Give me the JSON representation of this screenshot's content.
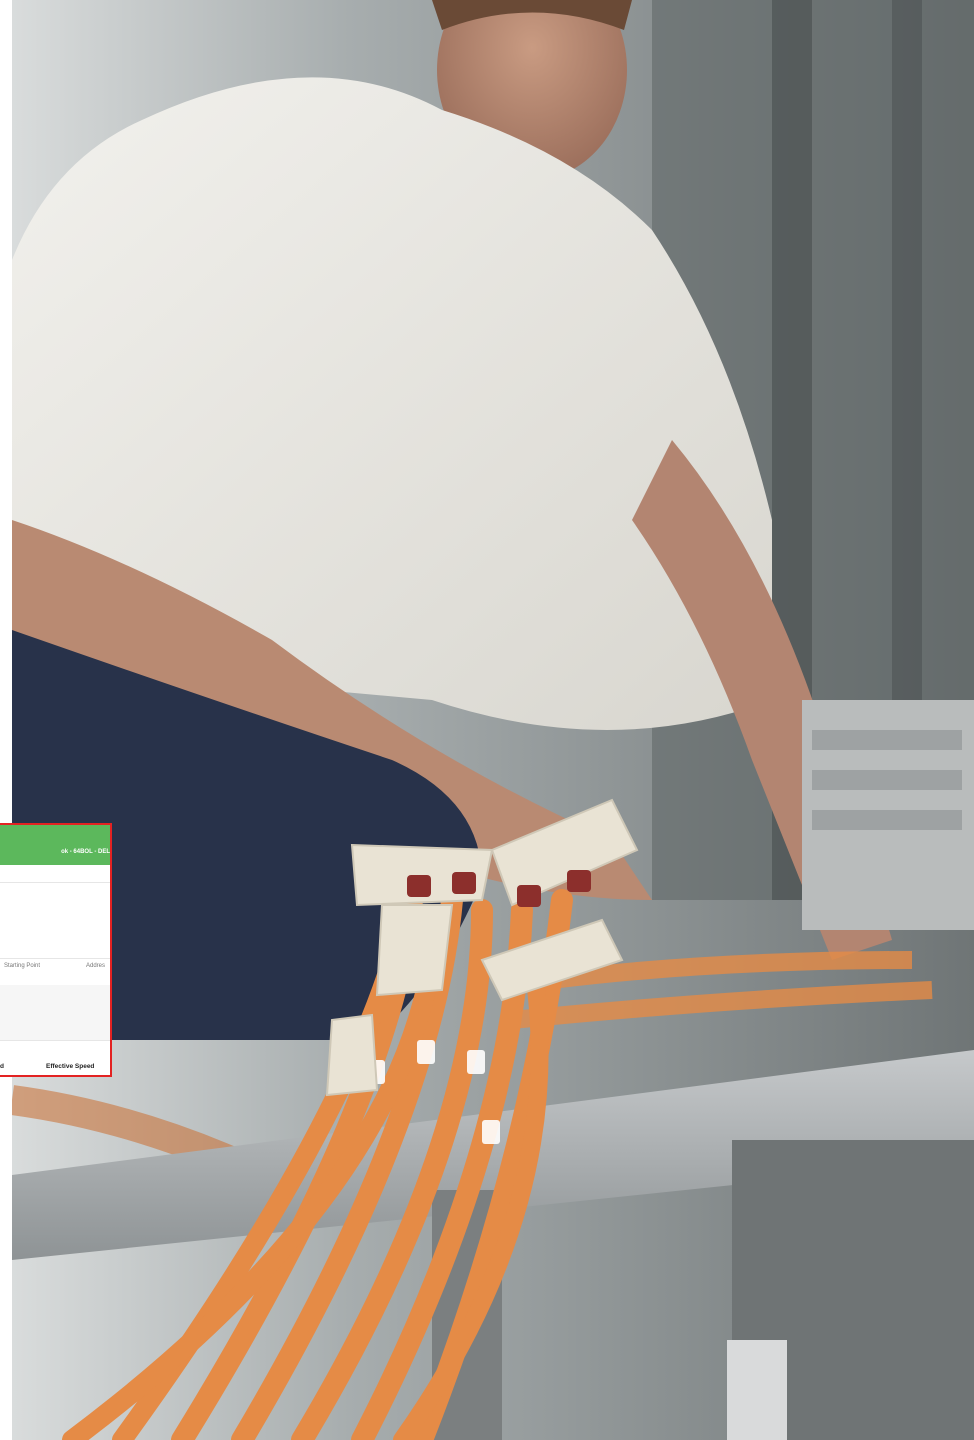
{
  "photo": {
    "subject": "technician-with-network-cables",
    "colors": {
      "background_gray": "#8a8f90",
      "shirt_white": "#ecebe6",
      "jeans_navy": "#28324a",
      "cable_orange": "#e58b46",
      "faceplate_cream": "#e9e3d4",
      "metal_bar": "#b4b8ba"
    }
  },
  "overlay": {
    "border_color": "#e32222",
    "bar_color": "#5cb85c",
    "bar_text": "ok - 64BOL - DEL",
    "col_starting_point": "Starting Point",
    "col_address": "Addres",
    "col_speed_left": "d",
    "col_effective_speed": "Effective Speed"
  }
}
